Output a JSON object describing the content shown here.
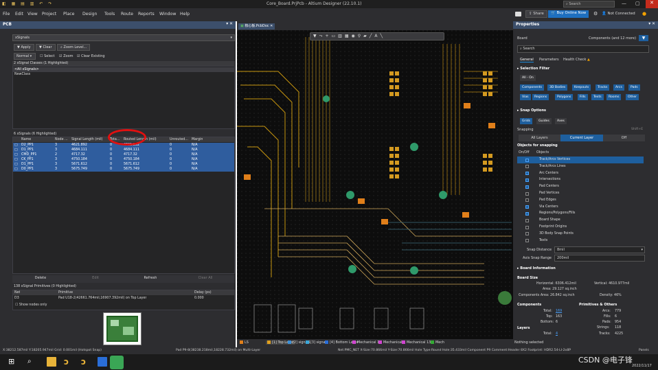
{
  "window": {
    "title": "Core_Board.PrjPcb - Altium Designer (22.10.1)",
    "search": "Search"
  },
  "menu": [
    "File",
    "Edit",
    "View",
    "Project",
    "Place",
    "Design",
    "Tools",
    "Route",
    "Reports",
    "Window",
    "Help"
  ],
  "toolbar_right": {
    "share": "Share",
    "buy": "Buy Online Now",
    "connection": "Not Connected"
  },
  "left": {
    "panel_title": "PCB",
    "mode_select": "xSignals",
    "apply": "Apply",
    "clear": "Clear",
    "zoom_level": "Zoom Level...",
    "normal": "Normal",
    "select": "Select",
    "zoom": "Zoom",
    "clear_existing": "Clear Existing",
    "classes_header": "2 xSignal Classes (1 Highlighted)",
    "classes": [
      "<All xSignals>",
      "NewClass"
    ],
    "signals_header": "6 xSignals (6 Highlighted)",
    "columns": [
      "Name",
      "Node ...",
      "Signal Length (mil)",
      "Tota...",
      "Routed Length (mil)",
      "Unrouted...",
      "Margin"
    ],
    "rows": [
      [
        "D2_PP1",
        "3",
        "4621.892",
        "0",
        "4621.892",
        "0",
        "N/A"
      ],
      [
        "D1_PP1",
        "3",
        "4684.111",
        "0",
        "4684.111",
        "0",
        "N/A"
      ],
      [
        "CMD_PP1",
        "2",
        "4717.32",
        "0",
        "4717.32",
        "0",
        "N/A"
      ],
      [
        "CK_PP1",
        "3",
        "4750.184",
        "0",
        "4750.184",
        "0",
        "N/A"
      ],
      [
        "D1_PP1",
        "3",
        "5671.612",
        "0",
        "5671.612",
        "0",
        "N/A"
      ],
      [
        "D0_PP1",
        "3",
        "5675.749",
        "0",
        "5675.749",
        "0",
        "N/A"
      ]
    ],
    "actions": [
      "Delete",
      "Edit",
      "Refresh",
      "Clear All"
    ],
    "prims_header": "138 xSignal Primitives (0 Highlighted)",
    "prim_columns": [
      "Net",
      "Primitive",
      "Delay (ps)"
    ],
    "prim_row": [
      "D3",
      "Pad U18-2(42661.764mil,16907.392mil) on Top Layer",
      "0.000"
    ],
    "show_nodes": "Show nodes only"
  },
  "doc_tab": "核心板.PcbDoc",
  "layers": [
    {
      "label": "LS",
      "color": "#e07f1a"
    },
    {
      "label": "[1] Top Layer",
      "color": "#e0a020"
    },
    {
      "label": "[2] signal1",
      "color": "#3a8fd8"
    },
    {
      "label": "[3] signal2",
      "color": "#3aa6d8"
    },
    {
      "label": "[4] Bottom Layer",
      "color": "#2a6ed8"
    },
    {
      "label": "Mechanical 1",
      "color": "#d044d0"
    },
    {
      "label": "Mechanical 6",
      "color": "#d044d0"
    },
    {
      "label": "Mechanical 13",
      "color": "#d044d0"
    },
    {
      "label": "Mech",
      "color": "#33aa33"
    }
  ],
  "right": {
    "title": "Properties",
    "board": "Board",
    "components": "Components (and 12 more)",
    "search": "Search",
    "tabs": [
      "General",
      "Parameters",
      "Health Check"
    ],
    "selection_filter": "Selection Filter",
    "all_on": "All - On",
    "filters": [
      "Components",
      "3D Bodies",
      "Keepouts",
      "Tracks",
      "Arcs",
      "Pads",
      "Vias",
      "Regions",
      "Polygons",
      "Fills",
      "Texts",
      "Rooms",
      "Other"
    ],
    "snap_options": "Snap Options",
    "snap_btns": [
      "Grids",
      "Guides",
      "Axes"
    ],
    "snapping": "Snapping",
    "shortcut": "Shift+E",
    "snap_layers": [
      "All Layers",
      "Current Layer",
      "Off"
    ],
    "objects_for_snapping": "Objects for snapping",
    "onoff": "On/Off",
    "objects": "Objects",
    "snap_items": [
      {
        "label": "Track/Arcs Vertices",
        "on": true,
        "hl": true
      },
      {
        "label": "Track/Arcs Lines",
        "on": false
      },
      {
        "label": "Arc Centers",
        "on": true
      },
      {
        "label": "Intersections",
        "on": true
      },
      {
        "label": "Pad Centers",
        "on": true
      },
      {
        "label": "Pad Vertices",
        "on": false
      },
      {
        "label": "Pad Edges",
        "on": false
      },
      {
        "label": "Via Centers",
        "on": true
      },
      {
        "label": "Regions/Polygons/Fills",
        "on": true
      },
      {
        "label": "Board Shape",
        "on": false
      },
      {
        "label": "Footprint Origins",
        "on": false
      },
      {
        "label": "3D Body Snap Points",
        "on": false
      },
      {
        "label": "Texts",
        "on": false
      }
    ],
    "snap_distance_label": "Snap Distance",
    "snap_distance": "8mil",
    "axis_snap_label": "Axis Snap Range",
    "axis_snap": "200mil",
    "board_info": "Board Information",
    "board_size": "Board Size",
    "horizontal": "Horizontal: 6306.412mil",
    "vertical": "Vertical: 4610.977mil",
    "area": "Area: 29.127 sq.inch",
    "comp_area": "Components Area: 26.842 sq.inch",
    "density": "Density: 46%",
    "components_h": "Components",
    "prims_h": "Primitives & Others",
    "total": "Total:",
    "total_v": "169",
    "top": "Top:",
    "top_v": "163",
    "bottom": "Bottom:",
    "bottom_v": "6",
    "arcs": "Arcs:",
    "arcs_v": "779",
    "fills": "Fills:",
    "fills_v": "6",
    "pads": "Pads:",
    "pads_v": "954",
    "strings": "Strings:",
    "strings_v": "118",
    "tracks": "Tracks:",
    "tracks_v": "4225",
    "layers_h": "Layers",
    "layers_total": "Total:",
    "layers_total_v": "4",
    "nothing": "Nothing selected"
  },
  "status": {
    "left": "X:38212.587mil Y:18205.947mil   Grid: 0.001mil   (Hotspot Snap)",
    "mid": "Pad P9-8(38238.218mil,18228.732mil) on Multi-Layer",
    "right": "Net:PMC_NET X-Size:70.866mil Y-Size:70.866mil Hole Type:Round Hole:35.433mil  Component P9 Comment:Header 8X2 Footprint: HDR2.54-LI-2x8P",
    "panels": "Panels"
  },
  "watermark": "CSDN @电子锋",
  "date": "2022/11/17"
}
